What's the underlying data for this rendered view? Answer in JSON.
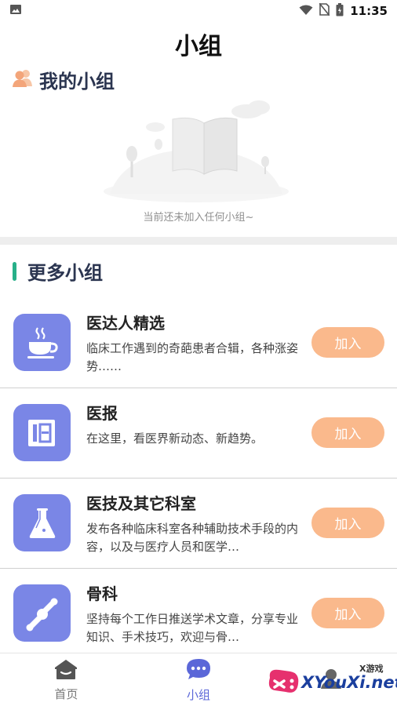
{
  "status_bar": {
    "time": "11:35"
  },
  "page": {
    "title": "小组"
  },
  "my_groups": {
    "title": "我的小组",
    "empty_text": "当前还未加入任何小组~"
  },
  "more_groups": {
    "title": "更多小组",
    "items": [
      {
        "name": "医达人精选",
        "desc": "临床工作遇到的奇葩患者合辑，各种涨姿势……",
        "join": "加入",
        "icon": "coffee-cup-icon"
      },
      {
        "name": "医报",
        "desc": "在这里，看医界新动态、新趋势。",
        "join": "加入",
        "icon": "newspaper-icon"
      },
      {
        "name": "医技及其它科室",
        "desc": "发布各种临床科室各种辅助技术手段的内容，以及与医疗人员和医学…",
        "join": "加入",
        "icon": "flask-icon"
      },
      {
        "name": "骨科",
        "desc": "坚持每个工作日推送学术文章，分享专业知识、手术技巧，欢迎与骨…",
        "join": "加入",
        "icon": "bone-joint-icon"
      }
    ]
  },
  "bottom_nav": {
    "items": [
      {
        "label": "首页",
        "icon": "home-icon",
        "active": false
      },
      {
        "label": "小组",
        "icon": "chat-bubble-icon",
        "active": true
      }
    ]
  },
  "watermark": {
    "text": "XYouXi.net",
    "small": "X游戏"
  },
  "colors": {
    "accent": "#27b089",
    "icon_bg": "#7a86e6",
    "join_bg": "#fab98c",
    "active_nav": "#5b67d8"
  }
}
